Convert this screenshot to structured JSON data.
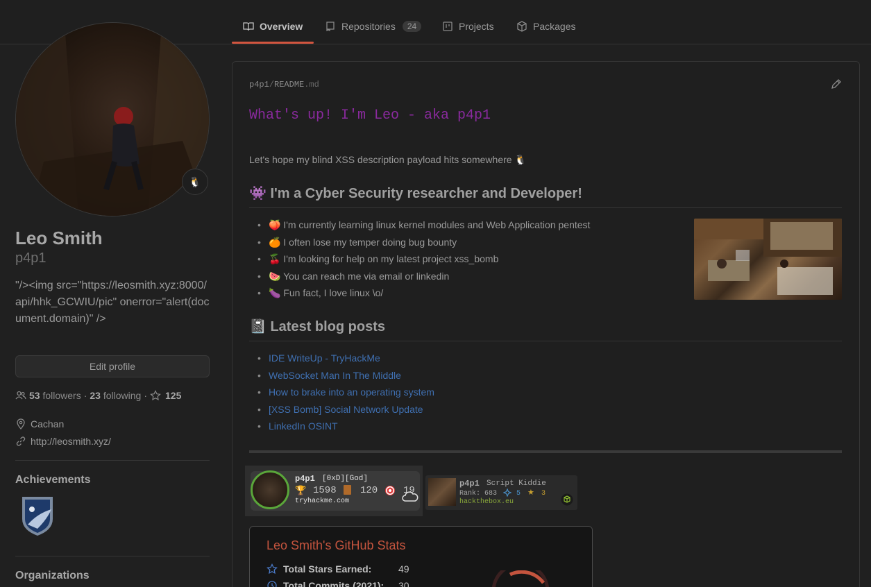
{
  "nav": {
    "tabs": [
      {
        "label": "Overview"
      },
      {
        "label": "Repositories",
        "count": "24"
      },
      {
        "label": "Projects"
      },
      {
        "label": "Packages"
      }
    ]
  },
  "profile": {
    "status_emoji": "🐧",
    "fullname": "Leo Smith",
    "username": "p4p1",
    "bio": "\"/><img src=\"https://leosmith.xyz:8000/api/hhk_GCWIU/pic\" onerror=\"alert(document.domain)\" />",
    "edit_label": "Edit profile",
    "followers_count": "53",
    "followers_label": "followers",
    "following_count": "23",
    "following_label": "following",
    "stars_count": "125",
    "location": "Cachan",
    "website": "http://leosmith.xyz/",
    "achievements_heading": "Achievements",
    "organizations_heading": "Organizations"
  },
  "readme": {
    "crumb_user": "p4p1",
    "crumb_slash": "/",
    "crumb_file": "README",
    "crumb_ext": ".md",
    "hello": "What's up! I'm Leo - aka p4p1",
    "intro": "Let's hope my blind XSS description payload hits somewhere 🐧",
    "section1_title": "👾 I'm a Cyber Security researcher and Developer!",
    "bullets": [
      "🍑 I'm currently learning linux kernel modules and Web Application pentest",
      "🍊 I often lose my temper doing bug bounty",
      "🍒 I'm looking for help on my latest project xss_bomb",
      "🍉 You can reach me via email or linkedin",
      "🍆 Fun fact, I love linux \\o/"
    ],
    "section2_title": "📓 Latest blog posts",
    "posts": [
      "IDE WriteUp - TryHackMe",
      "WebSocket Man In The Middle",
      "How to brake into an operating system",
      "[XSS Bomb] Social Network Update",
      "LinkedIn OSINT"
    ]
  },
  "thm": {
    "user": "p4p1",
    "rank": "[0xD][God]",
    "trophies": "1598",
    "rooms": "120",
    "target": "19",
    "site": "tryhackme.com"
  },
  "htb": {
    "user": "p4p1",
    "rank_title": "Script Kiddie",
    "rank_label": "Rank: 683",
    "respect": "5",
    "stars": "3",
    "site": "hackthebox.eu"
  },
  "stats": {
    "title": "Leo Smith's GitHub Stats",
    "rows": [
      {
        "label": "Total Stars Earned:",
        "value": "49"
      },
      {
        "label": "Total Commits (2021):",
        "value": "30"
      }
    ]
  },
  "colors": {
    "accent_underline": "#d2553f",
    "hello_purple": "#8a2a9e",
    "link_blue": "#3f6fb0",
    "stats_title": "#c4543e"
  }
}
